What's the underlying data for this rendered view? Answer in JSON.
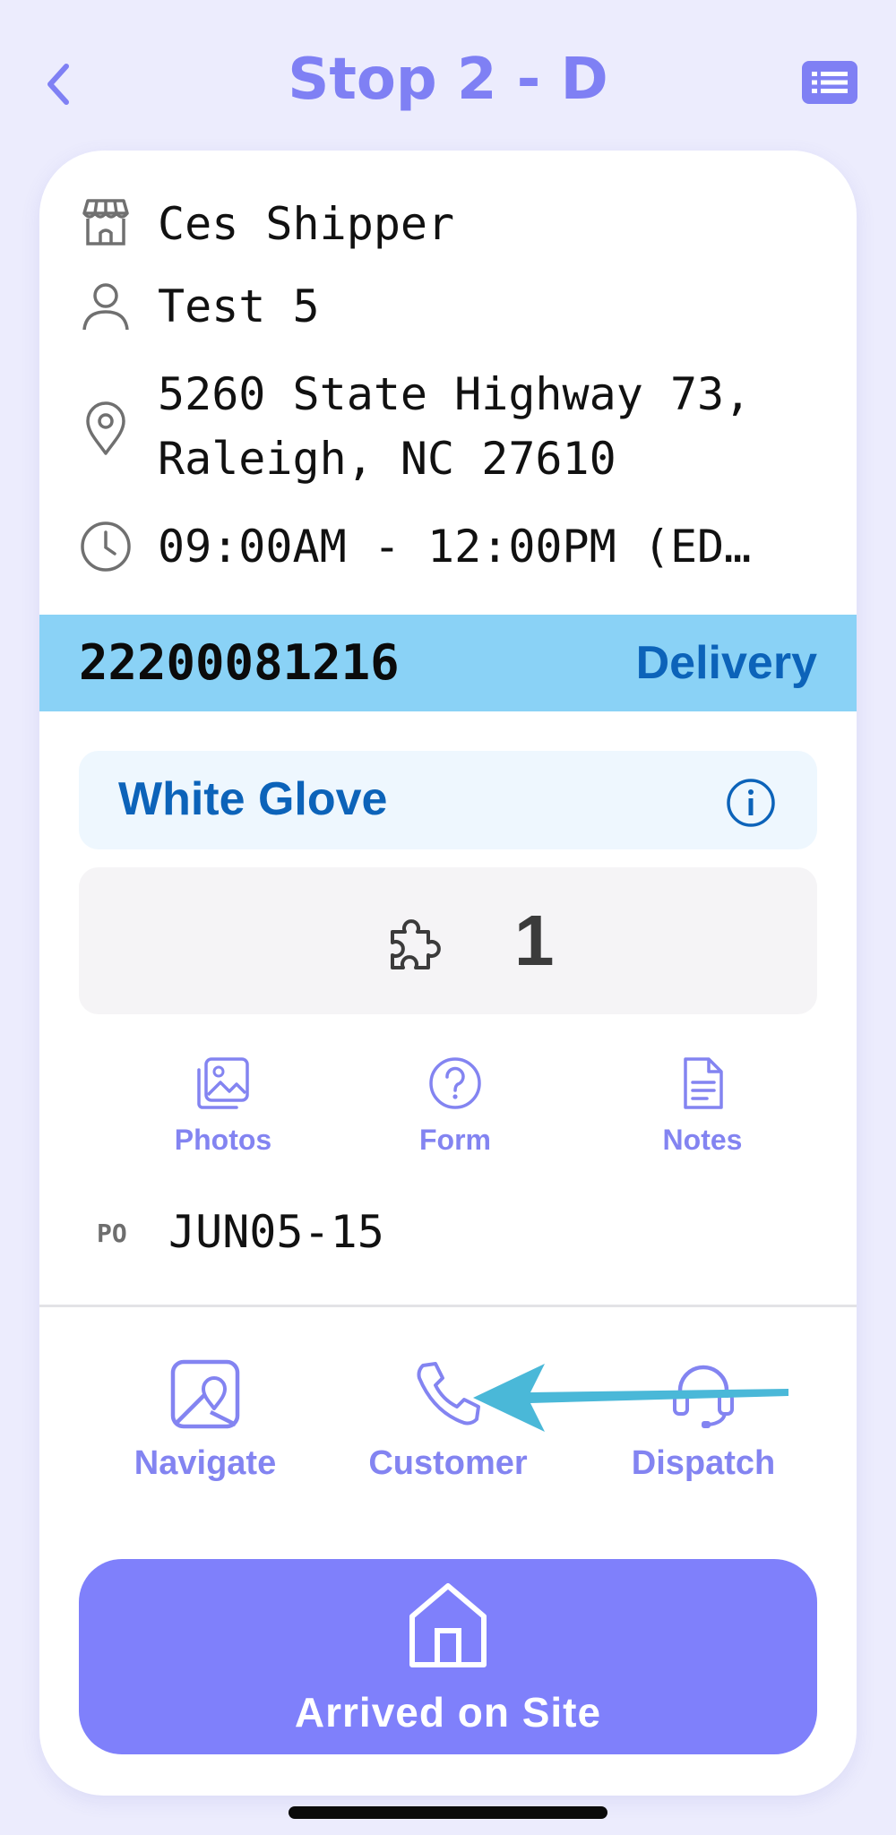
{
  "header": {
    "title": "Stop 2 - D",
    "back_icon": "chevron-left-icon",
    "list_icon": "list-icon"
  },
  "stop": {
    "shipper": "Ces Shipper",
    "contact": "Test 5",
    "address_line1": "5260 State Highway 73,",
    "address_line2": "Raleigh, NC 27610",
    "time_window": "09:00AM - 12:00PM (ED…"
  },
  "order": {
    "number": "22200081216",
    "type": "Delivery"
  },
  "service": {
    "label": "White Glove"
  },
  "pieces": {
    "count": "1"
  },
  "actions": {
    "photos": "Photos",
    "form": "Form",
    "notes": "Notes"
  },
  "po": {
    "label": "PO",
    "value": "JUN05-15"
  },
  "contact_actions": {
    "navigate": "Navigate",
    "customer": "Customer",
    "dispatch": "Dispatch"
  },
  "primary_action": {
    "label": "Arrived on Site"
  },
  "colors": {
    "accent": "#7f80fb",
    "order_bar": "#8ad2f6",
    "order_text": "#0c63b9",
    "arrow": "#4ab8d8"
  }
}
